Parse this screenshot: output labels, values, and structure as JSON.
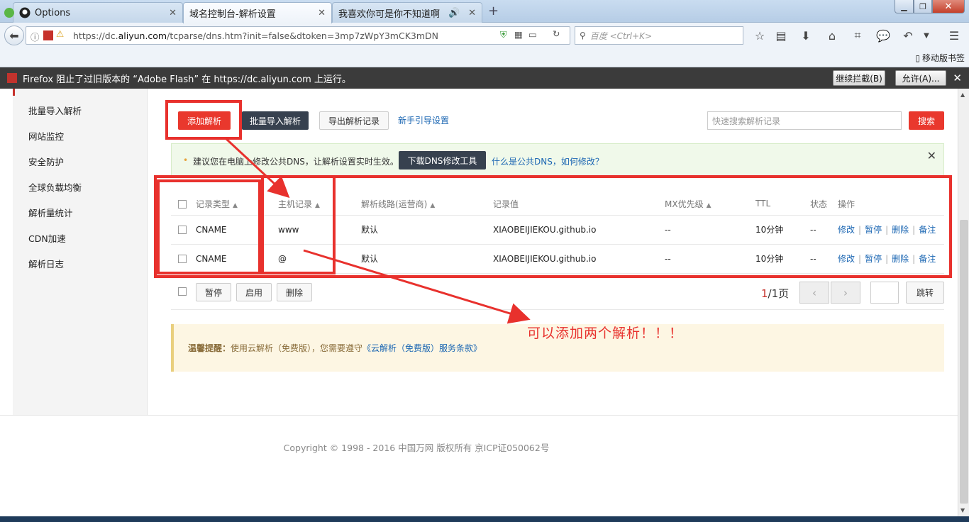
{
  "browser": {
    "tabs": [
      {
        "label": "Options",
        "icon": "github-icon"
      },
      {
        "label": "域名控制台-解析设置",
        "icon": ""
      },
      {
        "label": "我喜欢你可是你不知道啊",
        "icon": "speaker-icon"
      }
    ],
    "url_prefix": "https://dc.",
    "url_domain": "aliyun.com",
    "url_rest": "/tcparse/dns.htm?init=false&dtoken=3mp7zWpY3mCK3mDN",
    "search_placeholder": "百度 <Ctrl+K>",
    "mobile_bookmarks": "移动版书签",
    "flash_message": "Firefox 阻止了过旧版本的 “Adobe Flash” 在 https://dc.aliyun.com 上运行。",
    "flash_continue": "继续拦截(B)",
    "flash_allow": "允许(A)..."
  },
  "sidebar": {
    "items": [
      "批量导入解析",
      "网站监控",
      "安全防护",
      "全球负载均衡",
      "解析量统计",
      "CDN加速",
      "解析日志"
    ]
  },
  "toolbar": {
    "add": "添加解析",
    "batch_import": "批量导入解析",
    "export": "导出解析记录",
    "guide": "新手引导设置",
    "search_placeholder": "快速搜索解析记录",
    "search_button": "搜索"
  },
  "notice": {
    "text": "建议您在电脑上修改公共DNS，让解析设置实时生效。",
    "download_button": "下载DNS修改工具",
    "link": "什么是公共DNS，如何修改？"
  },
  "table": {
    "headers": [
      "记录类型",
      "主机记录",
      "解析线路(运营商)",
      "记录值",
      "MX优先级",
      "TTL",
      "状态",
      "操作"
    ],
    "rows": [
      {
        "type": "CNAME",
        "host": "www",
        "line": "默认",
        "value": "XIAOBEIJIEKOU.github.io",
        "mx": "--",
        "ttl": "10分钟",
        "status": "--"
      },
      {
        "type": "CNAME",
        "host": "@",
        "line": "默认",
        "value": "XIAOBEIJIEKOU.github.io",
        "mx": "--",
        "ttl": "10分钟",
        "status": "--"
      }
    ],
    "ops": [
      "修改",
      "暂停",
      "删除",
      "备注"
    ]
  },
  "bulk": {
    "pause": "暂停",
    "enable": "启用",
    "delete": "删除",
    "page_current": "1",
    "page_total": "/1页",
    "jump": "跳转"
  },
  "tip": {
    "label": "温馨提醒：",
    "text": "使用云解析（免费版），您需要遵守",
    "link": "《云解析（免费版）服务条款》"
  },
  "annotation": "可以添加两个解析！！！",
  "footer": {
    "copyright": "Copyright © 1998 - 2016 中国万网 版权所有 京ICP证050062号"
  },
  "colors": {
    "accent_red": "#e9382d",
    "dark_button": "#37414f",
    "link_blue": "#1c67b3",
    "annotation_red": "#e8312d"
  }
}
